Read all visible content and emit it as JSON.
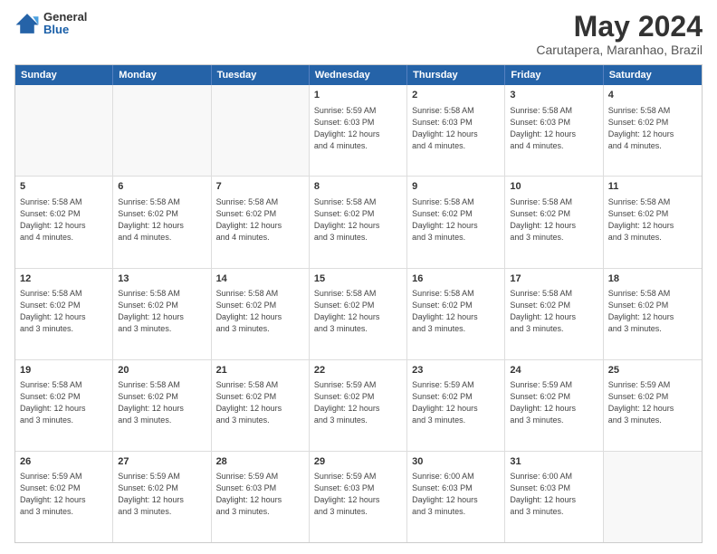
{
  "header": {
    "logo": {
      "general": "General",
      "blue": "Blue"
    },
    "title": "May 2024",
    "subtitle": "Carutapera, Maranhao, Brazil"
  },
  "weekdays": [
    "Sunday",
    "Monday",
    "Tuesday",
    "Wednesday",
    "Thursday",
    "Friday",
    "Saturday"
  ],
  "weeks": [
    [
      {
        "day": "",
        "info": ""
      },
      {
        "day": "",
        "info": ""
      },
      {
        "day": "",
        "info": ""
      },
      {
        "day": "1",
        "info": "Sunrise: 5:59 AM\nSunset: 6:03 PM\nDaylight: 12 hours\nand 4 minutes."
      },
      {
        "day": "2",
        "info": "Sunrise: 5:58 AM\nSunset: 6:03 PM\nDaylight: 12 hours\nand 4 minutes."
      },
      {
        "day": "3",
        "info": "Sunrise: 5:58 AM\nSunset: 6:03 PM\nDaylight: 12 hours\nand 4 minutes."
      },
      {
        "day": "4",
        "info": "Sunrise: 5:58 AM\nSunset: 6:02 PM\nDaylight: 12 hours\nand 4 minutes."
      }
    ],
    [
      {
        "day": "5",
        "info": "Sunrise: 5:58 AM\nSunset: 6:02 PM\nDaylight: 12 hours\nand 4 minutes."
      },
      {
        "day": "6",
        "info": "Sunrise: 5:58 AM\nSunset: 6:02 PM\nDaylight: 12 hours\nand 4 minutes."
      },
      {
        "day": "7",
        "info": "Sunrise: 5:58 AM\nSunset: 6:02 PM\nDaylight: 12 hours\nand 4 minutes."
      },
      {
        "day": "8",
        "info": "Sunrise: 5:58 AM\nSunset: 6:02 PM\nDaylight: 12 hours\nand 3 minutes."
      },
      {
        "day": "9",
        "info": "Sunrise: 5:58 AM\nSunset: 6:02 PM\nDaylight: 12 hours\nand 3 minutes."
      },
      {
        "day": "10",
        "info": "Sunrise: 5:58 AM\nSunset: 6:02 PM\nDaylight: 12 hours\nand 3 minutes."
      },
      {
        "day": "11",
        "info": "Sunrise: 5:58 AM\nSunset: 6:02 PM\nDaylight: 12 hours\nand 3 minutes."
      }
    ],
    [
      {
        "day": "12",
        "info": "Sunrise: 5:58 AM\nSunset: 6:02 PM\nDaylight: 12 hours\nand 3 minutes."
      },
      {
        "day": "13",
        "info": "Sunrise: 5:58 AM\nSunset: 6:02 PM\nDaylight: 12 hours\nand 3 minutes."
      },
      {
        "day": "14",
        "info": "Sunrise: 5:58 AM\nSunset: 6:02 PM\nDaylight: 12 hours\nand 3 minutes."
      },
      {
        "day": "15",
        "info": "Sunrise: 5:58 AM\nSunset: 6:02 PM\nDaylight: 12 hours\nand 3 minutes."
      },
      {
        "day": "16",
        "info": "Sunrise: 5:58 AM\nSunset: 6:02 PM\nDaylight: 12 hours\nand 3 minutes."
      },
      {
        "day": "17",
        "info": "Sunrise: 5:58 AM\nSunset: 6:02 PM\nDaylight: 12 hours\nand 3 minutes."
      },
      {
        "day": "18",
        "info": "Sunrise: 5:58 AM\nSunset: 6:02 PM\nDaylight: 12 hours\nand 3 minutes."
      }
    ],
    [
      {
        "day": "19",
        "info": "Sunrise: 5:58 AM\nSunset: 6:02 PM\nDaylight: 12 hours\nand 3 minutes."
      },
      {
        "day": "20",
        "info": "Sunrise: 5:58 AM\nSunset: 6:02 PM\nDaylight: 12 hours\nand 3 minutes."
      },
      {
        "day": "21",
        "info": "Sunrise: 5:58 AM\nSunset: 6:02 PM\nDaylight: 12 hours\nand 3 minutes."
      },
      {
        "day": "22",
        "info": "Sunrise: 5:59 AM\nSunset: 6:02 PM\nDaylight: 12 hours\nand 3 minutes."
      },
      {
        "day": "23",
        "info": "Sunrise: 5:59 AM\nSunset: 6:02 PM\nDaylight: 12 hours\nand 3 minutes."
      },
      {
        "day": "24",
        "info": "Sunrise: 5:59 AM\nSunset: 6:02 PM\nDaylight: 12 hours\nand 3 minutes."
      },
      {
        "day": "25",
        "info": "Sunrise: 5:59 AM\nSunset: 6:02 PM\nDaylight: 12 hours\nand 3 minutes."
      }
    ],
    [
      {
        "day": "26",
        "info": "Sunrise: 5:59 AM\nSunset: 6:02 PM\nDaylight: 12 hours\nand 3 minutes."
      },
      {
        "day": "27",
        "info": "Sunrise: 5:59 AM\nSunset: 6:02 PM\nDaylight: 12 hours\nand 3 minutes."
      },
      {
        "day": "28",
        "info": "Sunrise: 5:59 AM\nSunset: 6:03 PM\nDaylight: 12 hours\nand 3 minutes."
      },
      {
        "day": "29",
        "info": "Sunrise: 5:59 AM\nSunset: 6:03 PM\nDaylight: 12 hours\nand 3 minutes."
      },
      {
        "day": "30",
        "info": "Sunrise: 6:00 AM\nSunset: 6:03 PM\nDaylight: 12 hours\nand 3 minutes."
      },
      {
        "day": "31",
        "info": "Sunrise: 6:00 AM\nSunset: 6:03 PM\nDaylight: 12 hours\nand 3 minutes."
      },
      {
        "day": "",
        "info": ""
      }
    ]
  ]
}
